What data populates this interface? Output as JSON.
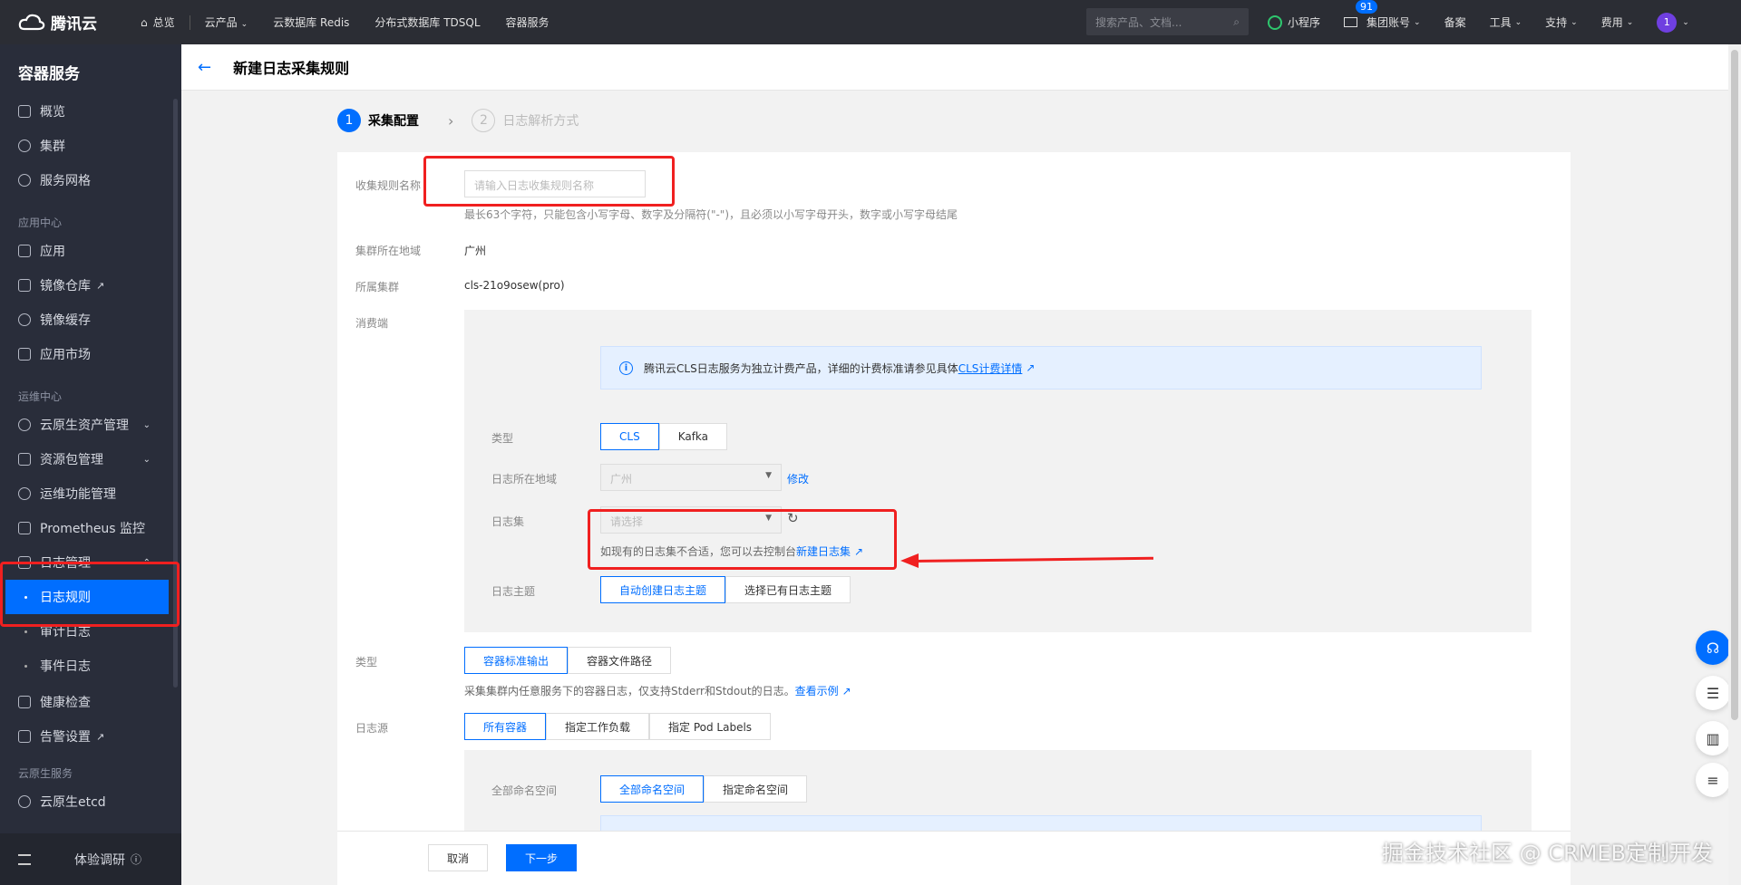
{
  "topbar": {
    "brand": "腾讯云",
    "home": "总览",
    "links": [
      "云产品",
      "云数据库 Redis",
      "分布式数据库 TDSQL",
      "容器服务"
    ],
    "search_placeholder": "搜索产品、文档...",
    "miniprogram": "小程序",
    "mail_badge": "91",
    "account": "集团账号",
    "filing": "备案",
    "tools": "工具",
    "support": "支持",
    "billing": "费用",
    "avatar": "1"
  },
  "sidebar": {
    "title": "容器服务",
    "top_items": [
      "概览",
      "集群",
      "服务网格"
    ],
    "group_app": "应用中心",
    "app_items": [
      "应用",
      "镜像仓库",
      "镜像缓存",
      "应用市场"
    ],
    "group_ops": "运维中心",
    "ops_items": [
      "云原生资产管理",
      "资源包管理",
      "运维功能管理",
      "Prometheus 监控",
      "日志管理"
    ],
    "log_sub": [
      "日志规则",
      "审计日志",
      "事件日志"
    ],
    "more_items": [
      "健康检查",
      "告警设置"
    ],
    "group_native": "云原生服务",
    "native_items": [
      "云原生etcd"
    ],
    "footer": "体验调研"
  },
  "header": {
    "title": "新建日志采集规则"
  },
  "steps": [
    {
      "num": "1",
      "label": "采集配置"
    },
    {
      "num": "2",
      "label": "日志解析方式"
    }
  ],
  "form": {
    "name_label": "收集规则名称",
    "name_placeholder": "请输入日志收集规则名称",
    "name_hint": "最长63个字符，只能包含小写字母、数字及分隔符(\"-\")，且必须以小写字母开头，数字或小写字母结尾",
    "region_label": "集群所在地域",
    "region_value": "广州",
    "cluster_label": "所属集群",
    "cluster_value": "cls-21o9osew(pro)",
    "consumer_label": "消费端",
    "info_text": "腾讯云CLS日志服务为独立计费产品，详细的计费标准请参见具体",
    "info_link": "CLS计费详情",
    "type_label": "类型",
    "type_options": [
      "CLS",
      "Kafka"
    ],
    "log_region_label": "日志所在地域",
    "log_region_value": "广州",
    "modify": "修改",
    "logset_label": "日志集",
    "logset_placeholder": "请选择",
    "logset_hint": "如现有的日志集不合适，您可以去控制台",
    "logset_link": "新建日志集",
    "topic_label": "日志主题",
    "topic_options": [
      "自动创建日志主题",
      "选择已有日志主题"
    ],
    "src_type_label": "类型",
    "src_type_options": [
      "容器标准输出",
      "容器文件路径"
    ],
    "src_type_hint": "采集集群内任意服务下的容器日志，仅支持Stderr和Stdout的日志。",
    "src_type_link": "查看示例",
    "source_label": "日志源",
    "source_options": [
      "所有容器",
      "指定工作负载",
      "指定 Pod Labels"
    ],
    "ns_label": "全部命名空间",
    "ns_options": [
      "全部命名空间",
      "指定命名空间"
    ]
  },
  "footer": {
    "cancel": "取消",
    "next": "下一步"
  },
  "watermark": "掘金技术社区 @ CRMEB定制开发",
  "colors": {
    "accent": "#006eff",
    "sidebar": "#292d3a",
    "topbar": "#2b2d34",
    "annotation": "#f02020"
  }
}
